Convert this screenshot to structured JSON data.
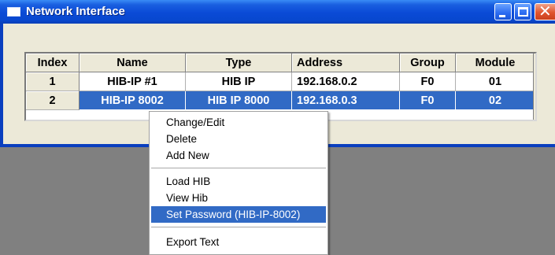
{
  "window": {
    "title": "Network Interface",
    "controls": {
      "minimize": "minimize-icon",
      "maximize": "maximize-icon",
      "close": "close-icon"
    }
  },
  "table": {
    "columns": [
      "Index",
      "Name",
      "Type",
      "Address",
      "Group",
      "Module"
    ],
    "rows": [
      {
        "index": "1",
        "name": "HIB-IP #1",
        "type": "HIB IP",
        "address": "192.168.0.2",
        "group": "F0",
        "module": "01"
      },
      {
        "index": "2",
        "name": "HIB-IP 8002",
        "type": "HIB IP 8000",
        "address": "192.168.0.3",
        "group": "F0",
        "module": "02"
      }
    ],
    "selected_row": 2
  },
  "context_menu": {
    "items": [
      "Change/Edit",
      "Delete",
      "Add New",
      "Load HIB",
      "View Hib",
      "Set Password (HIB-IP-8002)",
      "Export Text"
    ],
    "highlighted": "Set Password (HIB-IP-8002)"
  },
  "colors": {
    "titlebar": "#0a4ad6",
    "selection": "#316ac5",
    "desktop": "#808080",
    "client": "#ece9d8"
  }
}
